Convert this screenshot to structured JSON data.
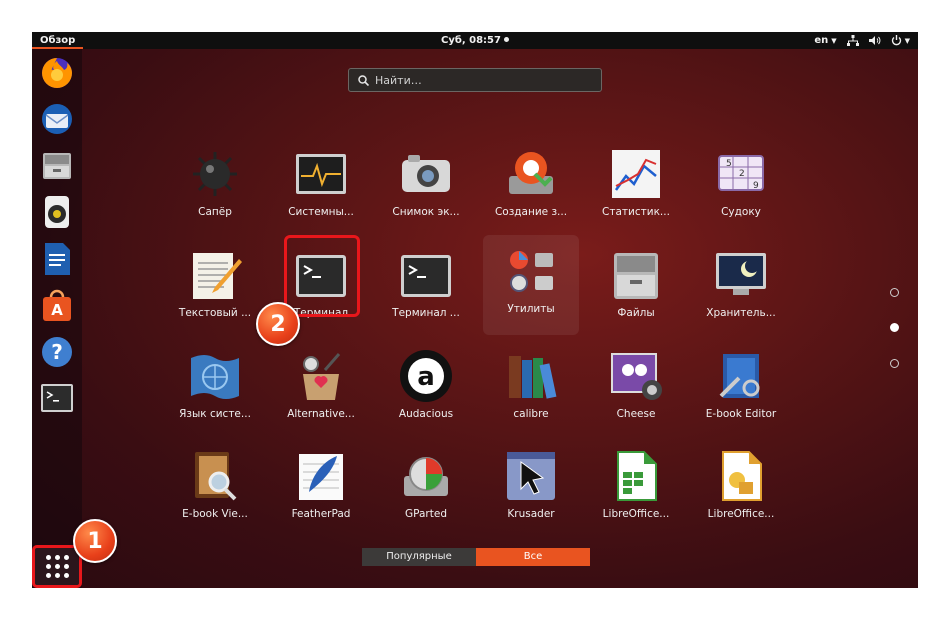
{
  "topbar": {
    "activities_label": "Обзор",
    "clock_label": "Суб, 08:57",
    "language_label": "en"
  },
  "dock": {
    "items": [
      {
        "name": "firefox-icon"
      },
      {
        "name": "thunderbird-icon"
      },
      {
        "name": "file-cabinet-icon"
      },
      {
        "name": "rhythmbox-icon"
      },
      {
        "name": "libreoffice-writer-icon"
      },
      {
        "name": "software-center-icon"
      },
      {
        "name": "help-icon"
      },
      {
        "name": "terminal-icon"
      }
    ]
  },
  "search": {
    "placeholder": "Найти…"
  },
  "apps": [
    {
      "label": "Сапёр"
    },
    {
      "label": "Системны..."
    },
    {
      "label": "Снимок эк..."
    },
    {
      "label": "Создание з..."
    },
    {
      "label": "Статистик..."
    },
    {
      "label": "Судоку"
    },
    {
      "label": "Текстовый ..."
    },
    {
      "label": "Терминал"
    },
    {
      "label": "Терминал ..."
    },
    {
      "label": "Утилиты"
    },
    {
      "label": "Файлы"
    },
    {
      "label": "Хранитель..."
    },
    {
      "label": "Язык систе..."
    },
    {
      "label": "Alternative..."
    },
    {
      "label": "Audacious"
    },
    {
      "label": "calibre"
    },
    {
      "label": "Cheese"
    },
    {
      "label": "E-book Editor"
    },
    {
      "label": "E-book Vie..."
    },
    {
      "label": "FeatherPad"
    },
    {
      "label": "GParted"
    },
    {
      "label": "Krusader"
    },
    {
      "label": "LibreOffice..."
    },
    {
      "label": "LibreOffice..."
    }
  ],
  "badges": {
    "one": "1",
    "two": "2"
  },
  "tabs": {
    "frequent": "Популярные",
    "all": "Все"
  },
  "colors": {
    "accent": "#e95420",
    "highlight": "#e8171b"
  }
}
